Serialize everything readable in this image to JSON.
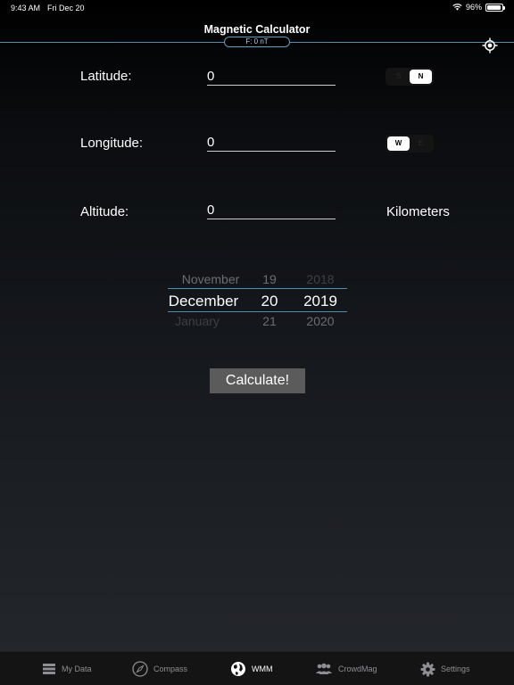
{
  "status": {
    "time": "9:43 AM",
    "date": "Fri Dec 20",
    "battery": "96%",
    "battery_level": 0.96
  },
  "nav": {
    "title": "Magnetic Calculator",
    "field": "F: 0 nT"
  },
  "form": {
    "latitude": {
      "label": "Latitude:",
      "value": "0",
      "options": [
        "S",
        "N"
      ],
      "selected": "N"
    },
    "longitude": {
      "label": "Longitude:",
      "value": "0",
      "options": [
        "W",
        "E"
      ],
      "selected": "W"
    },
    "altitude": {
      "label": "Altitude:",
      "value": "0",
      "unit": "Kilometers"
    }
  },
  "picker": {
    "months": [
      "November",
      "December",
      "January"
    ],
    "days": [
      "19",
      "20",
      "21"
    ],
    "years": [
      "2018",
      "2019",
      "2020"
    ],
    "selected": {
      "month": "December",
      "day": "20",
      "year": "2019"
    }
  },
  "calculate_label": "Calculate!",
  "tabs": [
    {
      "label": "My Data",
      "icon": "database-icon"
    },
    {
      "label": "Compass",
      "icon": "compass-icon"
    },
    {
      "label": "WMM",
      "icon": "globe-icon",
      "active": true
    },
    {
      "label": "CrowdMag",
      "icon": "crowd-icon"
    },
    {
      "label": "Settings",
      "icon": "gear-icon"
    }
  ],
  "colors": {
    "accent": "#4a8fb0",
    "button": "#5b5b5b",
    "tabbar": "#141414"
  }
}
